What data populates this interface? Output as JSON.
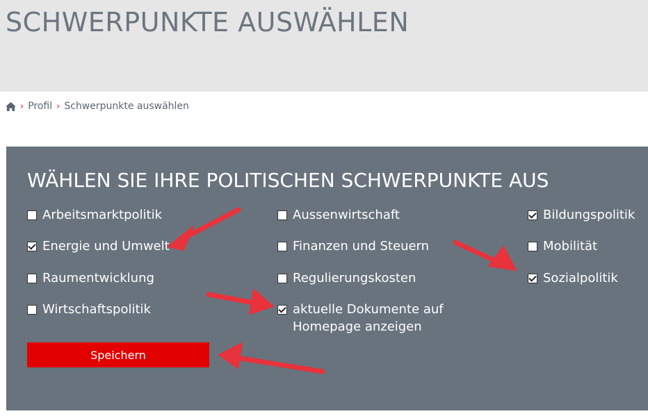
{
  "page": {
    "title": "SCHWERPUNKTE AUSWÄHLEN"
  },
  "breadcrumb": {
    "home_icon": "home-icon",
    "separator": "›",
    "items": [
      "Profil",
      "Schwerpunkte auswählen"
    ]
  },
  "section": {
    "title": "WÄHLEN SIE IHRE POLITISCHEN SCHWERPUNKTE AUS"
  },
  "checkboxes": [
    {
      "label": "Arbeitsmarktpolitik",
      "checked": false
    },
    {
      "label": "Aussenwirtschaft",
      "checked": false
    },
    {
      "label": "Bildungspolitik",
      "checked": true
    },
    {
      "label": "Energie und Umwelt",
      "checked": true
    },
    {
      "label": "Finanzen und Steuern",
      "checked": false
    },
    {
      "label": "Mobilität",
      "checked": false
    },
    {
      "label": "Raumentwicklung",
      "checked": false
    },
    {
      "label": "Regulierungskosten",
      "checked": false
    },
    {
      "label": "Sozialpolitik",
      "checked": true
    },
    {
      "label": "Wirtschaftspolitik",
      "checked": false
    },
    {
      "label": "aktuelle Dokumente auf Homepage anzeigen",
      "checked": true
    }
  ],
  "save_button": {
    "label": "Speichern"
  },
  "colors": {
    "header_band": "#e6e6e6",
    "panel": "#68737d",
    "accent_red": "#e30000",
    "annotation_arrow": "#e8323c"
  }
}
